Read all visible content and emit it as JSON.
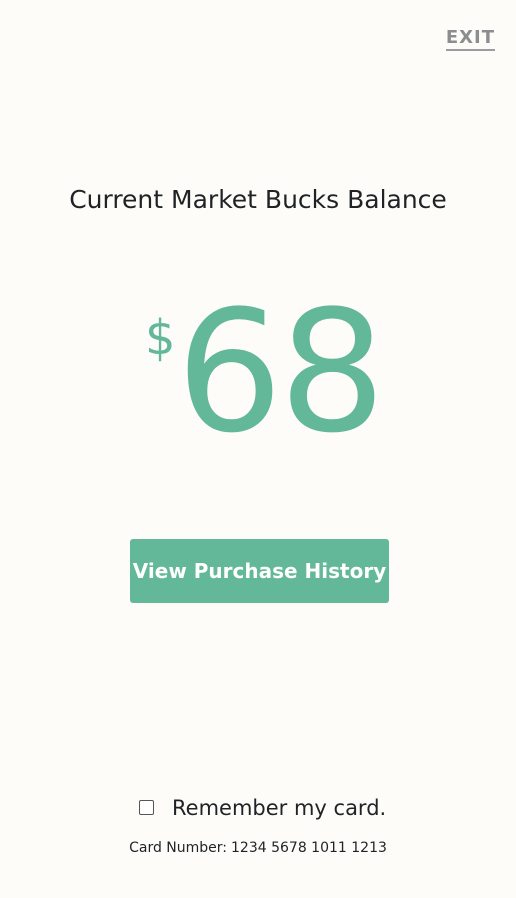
{
  "header": {
    "exit_label": "EXIT"
  },
  "balance": {
    "title": "Current Market Bucks Balance",
    "currency_symbol": "$",
    "amount": "68"
  },
  "actions": {
    "view_history_label": "View Purchase History"
  },
  "footer": {
    "remember_label": "Remember my card.",
    "remember_checked": false,
    "card_number_label": "Card Number:",
    "card_number_value": "1234 5678 1011 1213"
  },
  "colors": {
    "accent": "#63b89a",
    "background": "#fdfcf9",
    "text": "#1f2326",
    "muted": "#8b8d8f"
  }
}
